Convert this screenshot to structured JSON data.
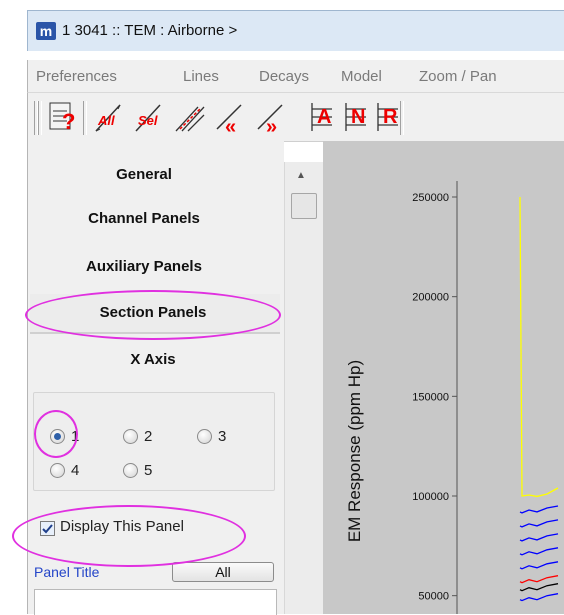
{
  "window": {
    "icon_letter": "m",
    "title": "1 3041 :: TEM : Airborne >"
  },
  "menu": [
    "Preferences",
    "Lines",
    "Decays",
    "Model",
    "Zoom / Pan"
  ],
  "toolbar": {
    "buttons": [
      {
        "name": "query-icon",
        "label": "?"
      },
      {
        "name": "all-icon",
        "label": "All"
      },
      {
        "name": "sel-icon",
        "label": "Sel"
      },
      {
        "name": "stack-lines-icon",
        "label": ""
      },
      {
        "name": "prev-line-icon",
        "label": "«"
      },
      {
        "name": "next-line-icon",
        "label": "»"
      },
      {
        "name": "panel-a-icon",
        "label": "A"
      },
      {
        "name": "panel-n-icon",
        "label": "N"
      },
      {
        "name": "panel-r-icon",
        "label": "R"
      }
    ]
  },
  "left_panel": {
    "tabs": [
      "General",
      "Channel Panels",
      "Auxiliary Panels",
      "Section Panels",
      "X Axis"
    ],
    "radio_options": [
      "1",
      "2",
      "3",
      "4",
      "5"
    ],
    "radio_selected": "1",
    "display_checkbox": {
      "label": "Display This Panel",
      "checked": true
    },
    "panel_title_label": "Panel Title",
    "all_button": "All",
    "panel_title_value": ""
  },
  "colors": {
    "highlight": "#e030e0",
    "plot_bg": "#c8c8c8"
  },
  "chart_data": {
    "type": "line",
    "ylabel": "EM Response (ppm Hp)",
    "yticks": [
      250000,
      200000,
      150000,
      100000,
      50000
    ],
    "ytick_labels": [
      "250000",
      "200000",
      "150000",
      "100000",
      "50000"
    ],
    "ylim": [
      40000,
      262000
    ],
    "series": [
      {
        "color": "#ffff00",
        "values": [
          250000,
          100000,
          100500,
          99800,
          101000,
          104000
        ]
      },
      {
        "color": "#0000ff",
        "values": [
          92000,
          91500,
          93000,
          92000,
          94000,
          95000
        ]
      },
      {
        "color": "#0000ff",
        "values": [
          85000,
          84500,
          86000,
          85000,
          87000,
          88000
        ]
      },
      {
        "color": "#0000ff",
        "values": [
          78000,
          77500,
          79000,
          78000,
          80000,
          81000
        ]
      },
      {
        "color": "#0000ff",
        "values": [
          71000,
          70500,
          72000,
          71000,
          73000,
          74000
        ]
      },
      {
        "color": "#0000ff",
        "values": [
          64000,
          63500,
          65000,
          64000,
          66000,
          67000
        ]
      },
      {
        "color": "#ff0000",
        "values": [
          57000,
          56500,
          58000,
          57000,
          59000,
          60000
        ]
      },
      {
        "color": "#000000",
        "values": [
          53000,
          52500,
          54000,
          53000,
          55000,
          56000
        ]
      },
      {
        "color": "#0000ff",
        "values": [
          48000,
          47500,
          49000,
          48000,
          50000,
          51000
        ]
      }
    ]
  }
}
